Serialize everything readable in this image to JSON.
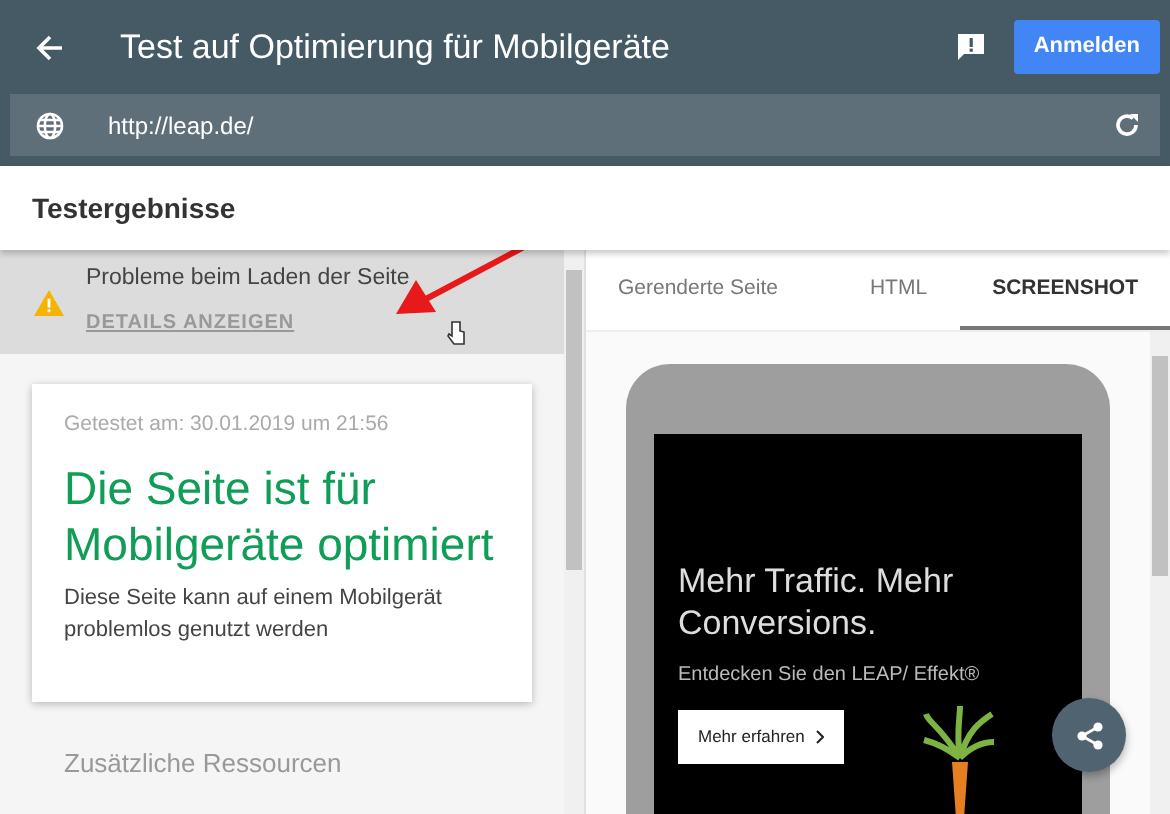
{
  "header": {
    "title": "Test auf Optimierung für Mobilgeräte",
    "login_button": "Anmelden"
  },
  "url_bar": {
    "value": "http://leap.de/"
  },
  "section_title": "Testergebnisse",
  "warning": {
    "message": "Probleme beim Laden der Seite",
    "link": "DETAILS ANZEIGEN"
  },
  "result_card": {
    "tested_at": "Getestet am: 30.01.2019 um 21:56",
    "verdict": "Die Seite ist für Mobilgeräte optimiert",
    "description": "Diese Seite kann auf einem Mobilgerät problemlos genutzt werden"
  },
  "more_heading": "Zusätzliche Ressourcen",
  "tabs": [
    {
      "label": "Gerenderte Seite",
      "selected": false
    },
    {
      "label": "HTML",
      "selected": false
    },
    {
      "label": "SCREENSHOT",
      "selected": true
    }
  ],
  "preview": {
    "headline": "Mehr Traffic. Mehr Conversions.",
    "tagline": "Entdecken Sie den LEAP/ Effekt®",
    "button": "Mehr erfahren"
  }
}
